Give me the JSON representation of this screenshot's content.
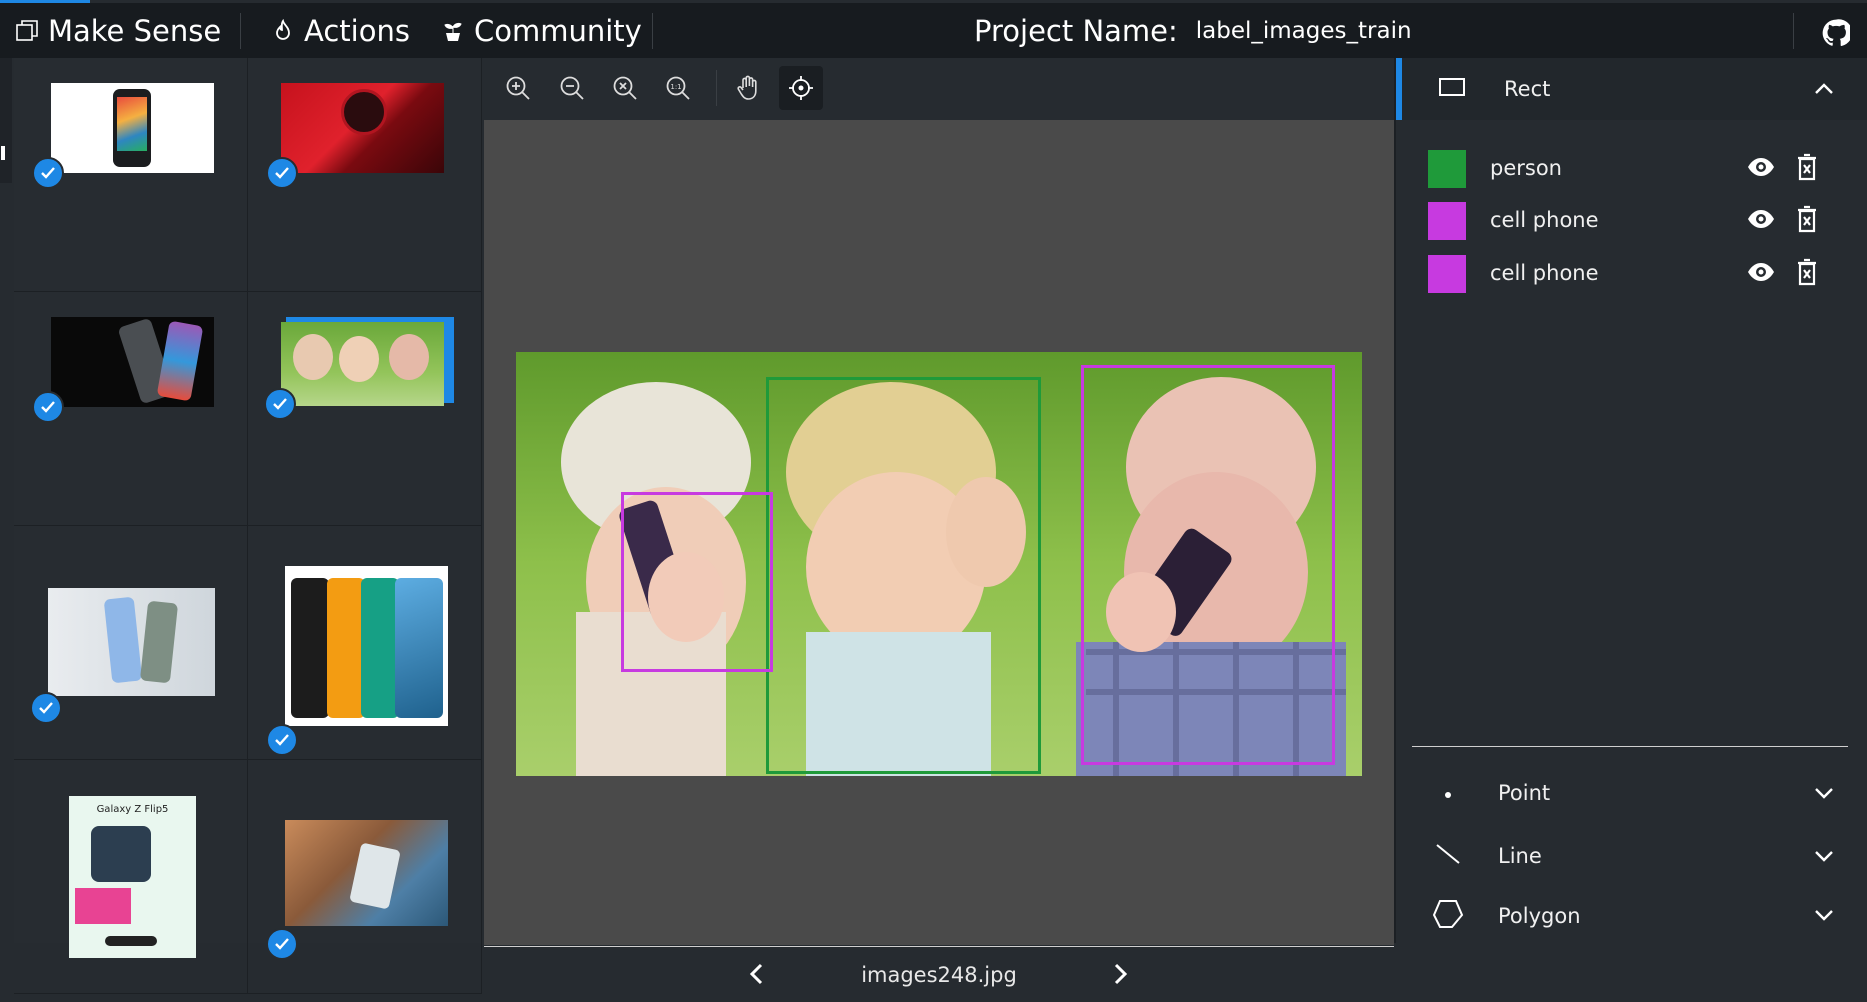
{
  "nav": {
    "brand": "Make Sense",
    "actions": "Actions",
    "community": "Community"
  },
  "project": {
    "label": "Project Name:",
    "name": "label_images_train"
  },
  "gallery": {
    "items": [
      {
        "title": "",
        "checked": true,
        "selected": false
      },
      {
        "title": "",
        "checked": true,
        "selected": false
      },
      {
        "title": "",
        "checked": true,
        "selected": false
      },
      {
        "title": "",
        "checked": true,
        "selected": true
      },
      {
        "title": "",
        "checked": true,
        "selected": false
      },
      {
        "title": "",
        "checked": true,
        "selected": false
      },
      {
        "title": "Galaxy Z Flip5",
        "checked": false,
        "selected": false
      },
      {
        "title": "",
        "checked": true,
        "selected": false
      }
    ]
  },
  "toolbar": {
    "tools": [
      "zoom-in-icon",
      "zoom-out-icon",
      "zoom-fit-icon",
      "zoom-actual-icon",
      "pan-hand-icon",
      "crosshair-icon"
    ],
    "active_tool": "crosshair-icon"
  },
  "canvas": {
    "file_name": "images248.jpg",
    "boxes": [
      {
        "label": "person",
        "color": "#1f9a3a"
      },
      {
        "label": "cell phone",
        "color": "#c73ae0"
      },
      {
        "label": "cell phone",
        "color": "#c73ae0"
      }
    ]
  },
  "panel": {
    "label_types": [
      {
        "name": "Rect",
        "icon": "rect-icon",
        "expanded": true
      },
      {
        "name": "Point",
        "icon": "point-icon",
        "expanded": false
      },
      {
        "name": "Line",
        "icon": "line-icon",
        "expanded": false
      },
      {
        "name": "Polygon",
        "icon": "polygon-icon",
        "expanded": false
      }
    ],
    "labels": [
      {
        "name": "person",
        "color": "#1f9a3a"
      },
      {
        "name": "cell phone",
        "color": "#c73ae0"
      },
      {
        "name": "cell phone",
        "color": "#c73ae0"
      }
    ]
  },
  "colors": {
    "accent": "#1e88e5",
    "topbar": "#171b1f",
    "panel": "#262b30",
    "canvas": "#4a4a4a"
  }
}
